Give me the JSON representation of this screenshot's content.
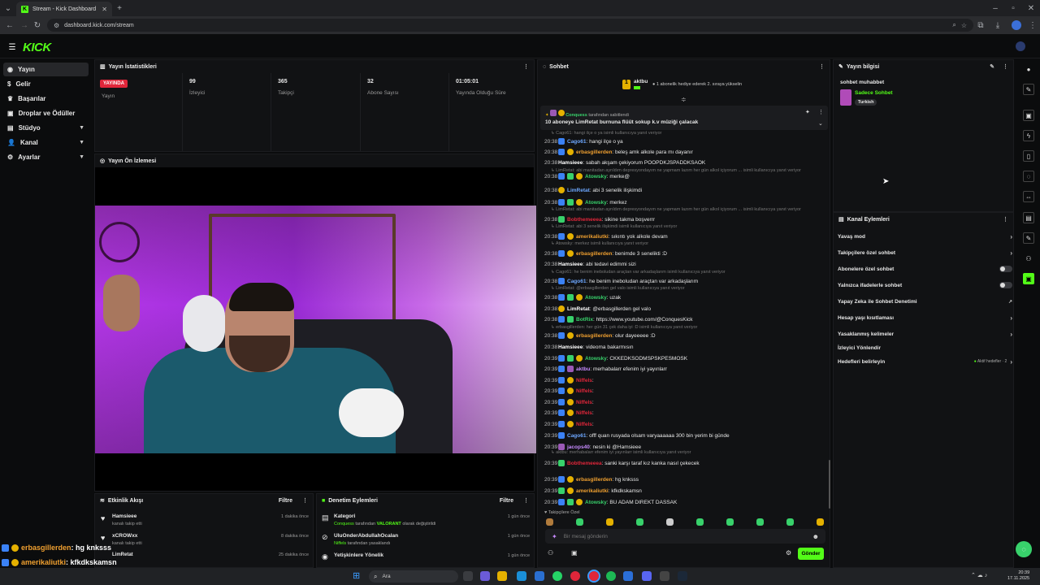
{
  "browser": {
    "tab_title": "Stream - Kick Dashboard",
    "url": "dashboard.kick.com/stream"
  },
  "brand": {
    "logo": "KICK",
    "accent": "#53fc18"
  },
  "sidebar": {
    "items": [
      {
        "label": "Yayın"
      },
      {
        "label": "Gelir"
      },
      {
        "label": "Başarılar"
      },
      {
        "label": "Droplar ve Ödüller"
      },
      {
        "label": "Stüdyo"
      },
      {
        "label": "Kanal"
      },
      {
        "label": "Ayarlar"
      }
    ]
  },
  "stats": {
    "title": "Yayın İstatistikleri",
    "badge": "YAYINDA",
    "badge_label": "Yayın",
    "items": [
      {
        "value": "99",
        "label": "İzleyici"
      },
      {
        "value": "365",
        "label": "Takipçi"
      },
      {
        "value": "32",
        "label": "Abone Sayısı"
      },
      {
        "value": "01:05:01",
        "label": "Yayında Olduğu Süre"
      }
    ]
  },
  "preview": {
    "title": "Yayın Ön İzlemesi"
  },
  "activity": {
    "title": "Etkinlik Akışı",
    "filter": "Filtre",
    "rows": [
      {
        "name": "Hamsieee",
        "sub": "kanalı takip etti",
        "time": "1 dakika önce"
      },
      {
        "name": "xCROWxx",
        "sub": "kanalı takip etti",
        "time": "8 dakika önce"
      },
      {
        "name": "LimRetat",
        "sub": "",
        "time": "25 dakika önce"
      }
    ]
  },
  "moderation": {
    "title": "Denetim Eylemleri",
    "filter": "Filtre",
    "rows": [
      {
        "name": "Kategori",
        "sub_user": "Conquess",
        "sub_mid": "tarafından",
        "sub_val": "VALORANT",
        "sub_end": "olarak değiştirildi",
        "time": "1 gün önce"
      },
      {
        "name": "UluOnderAbdullahOcalan",
        "sub_user": "Niffels",
        "sub_mid": "tarafından yasaklandı",
        "sub_val": "",
        "sub_end": "",
        "time": "1 gün önce"
      },
      {
        "name": "Yetişkinlere Yönelik",
        "sub_user": "",
        "sub_mid": "",
        "sub_val": "",
        "sub_end": "",
        "time": "1 gün önce"
      }
    ]
  },
  "chat": {
    "title": "Sohbet",
    "gift_user": "aktbu",
    "gift_count": "1",
    "gift_text": "1 abonelik hediye ederek 2. sıraya yükselin",
    "pinned_by": "Conquess",
    "pinned_by_suffix": "tarafından sabitlendi",
    "pinned_text": "10 aboneye LimRetat burnuna flüüt sokup k.v müziği çalacak",
    "lines": [
      {
        "time": "20:38",
        "user": "Cago61",
        "text": ": hangi ilçe o ya",
        "color": "#6ea8ff"
      },
      {
        "time": "20:38",
        "user": "erbasgillerden",
        "text": ": beleş amk alkole para mı dayanır",
        "color": "#f0a030"
      },
      {
        "time": "20:38",
        "user": "Hamsieee",
        "text": ": sabah akşam çekiyorum POOPDKJSPADDKSAOK",
        "color": "#fff"
      },
      {
        "time": "20:38",
        "user": "Atowsky",
        "text": ": merke@",
        "color": "#38d16b"
      },
      {
        "time": "20:38",
        "user": "LimRetat",
        "text": ": abi 3 senelik ilişkimdi",
        "color": "#6ea8ff"
      },
      {
        "time": "20:38",
        "user": "Atowsky",
        "text": ": merkez",
        "color": "#38d16b"
      },
      {
        "time": "20:38",
        "user": "Bobthemeeea",
        "text": ": sikine takma boşverrr",
        "color": "#e0263a"
      },
      {
        "time": "20:38",
        "user": "amerikaliutki",
        "text": ": sıkıntı yok alkole devam",
        "color": "#f0a030"
      },
      {
        "time": "20:38",
        "user": "erbasgillerden",
        "text": ": benimde 3 senelikti :D",
        "color": "#f0a030"
      },
      {
        "time": "20:38",
        "user": "Hamsieee",
        "text": ": abi tedavi edimmi sizi",
        "color": "#fff"
      },
      {
        "time": "20:38",
        "user": "Cago61",
        "text": ": he benim ineboludan araçtan var arkadaşlarım",
        "color": "#6ea8ff"
      },
      {
        "time": "20:38",
        "user": "Atowsky",
        "text": ": uzak",
        "color": "#38d16b"
      },
      {
        "time": "20:38",
        "user": "LimRetat",
        "text": ": @erbasgillerden gel valo",
        "color": "#fff"
      },
      {
        "time": "20:38",
        "user": "BotRix",
        "text": ": https://www.youtube.com/@ConquesKick",
        "color": "#38d16b"
      },
      {
        "time": "20:38",
        "user": "erbasgillerden",
        "text": ": olur dayeeeee :D",
        "color": "#f0a030"
      },
      {
        "time": "20:38",
        "user": "Hamsieee",
        "text": ": videoma bakarmısın",
        "color": "#fff"
      },
      {
        "time": "20:39",
        "user": "Atowsky",
        "text": ": CKKEDKSODMSPSKPESMOSK",
        "color": "#38d16b"
      },
      {
        "time": "20:39",
        "user": "aktbu",
        "text": ": merhabalarr efenim iyi yayınlarr",
        "color": "#c78bff"
      },
      {
        "time": "20:39",
        "user": "Niffels",
        "text": ": ",
        "color": "#e0263a"
      },
      {
        "time": "20:39",
        "user": "Niffels",
        "text": ": ",
        "color": "#e0263a"
      },
      {
        "time": "20:39",
        "user": "Niffels",
        "text": ": ",
        "color": "#e0263a"
      },
      {
        "time": "20:39",
        "user": "Niffels",
        "text": ": ",
        "color": "#e0263a"
      },
      {
        "time": "20:39",
        "user": "Niffels",
        "text": ": ",
        "color": "#e0263a"
      },
      {
        "time": "20:39",
        "user": "Cago61",
        "text": ": offf quan rusyada olsam varyaaaaaa 300 bin yerim bi günde",
        "color": "#6ea8ff"
      },
      {
        "time": "20:39",
        "user": "jacops40",
        "text": ": nesin ki @Hamsieee",
        "color": "#c78bff"
      },
      {
        "time": "20:39",
        "user": "Bobthemeeea",
        "text": ": sanki karşı taraf kız kanka nasıl çekecek",
        "color": "#e0263a"
      },
      {
        "time": "20:39",
        "user": "erbasgillerden",
        "text": ": hg knksss",
        "color": "#f0a030"
      },
      {
        "time": "20:39",
        "user": "amerikaliutki",
        "text": ": kfkdkskamsn",
        "color": "#f0a030"
      },
      {
        "time": "20:39",
        "user": "Atowsky",
        "text": ": BU ADAM DIREKT DASSAK",
        "color": "#38d16b"
      }
    ],
    "replies": [
      "Cago61: hangi ilçe o ya isimli kullanıcıya yanıt veriyor",
      "LimRetat: abi manitadan ayrıldım depresyondayım ne yapmam lazım her gün alkol içiyorum ... isimli kullanıcıya yanıt veriyor",
      "LimRetat: abi manitadan ayrıldım depresyondayım ne yapmam lazım her gün alkol içiyorum ... isimli kullanıcıya yanıt veriyor",
      "LimRetat: abi 3 senelik ilişkimdi isimli kullanıcıya yanıt veriyor",
      "Atowsky: merkez isimli kullanıcıya yanıt veriyor",
      "Cago61: he benim ineboludan araçtan var arkadaşlarım isimli kullanıcıya yanıt veriyor",
      "LimRetat: @erbasgillerden gel valo isimli kullanıcıya yanıt veriyor",
      "erbasgillerden: her gün 31 çek daha iyi :D isimli kullanıcıya yanıt veriyor",
      "aktbu: merhabalarr efenim iyi yayınlarr isimli kullanıcıya yanıt veriyor"
    ],
    "followers_only": "Takipçilere Özel",
    "placeholder": "Bir mesaj gönderin",
    "send": "Gönder"
  },
  "stream_info": {
    "title": "Yayın bilgisi",
    "stream_title": "sohbet muhabbet",
    "category": "Sadece Sohbet",
    "tag": "Turkish"
  },
  "channel_actions": {
    "title": "Kanal Eylemleri",
    "items": [
      {
        "label": "Yavaş mod"
      },
      {
        "label": "Takipçilere özel sohbet"
      },
      {
        "label": "Abonelere özel sohbet"
      },
      {
        "label": "Yalnızca ifadelerle sohbet"
      },
      {
        "label": "Yapay Zeka ile Sohbet Denetimi"
      },
      {
        "label": "Hesap yaşı kısıtlaması"
      },
      {
        "label": "Yasaklanmış kelimeler"
      },
      {
        "label": "İzleyici Yönlendir"
      },
      {
        "label": "Hedefleri belirleyin"
      }
    ],
    "goals_status": "Aktif hedefler · 2"
  },
  "overlay": {
    "lines": [
      {
        "user": "erbasgillerden",
        "text": ": hg knksss",
        "color": "#f0a030"
      },
      {
        "user": "amerikaliutki",
        "text": ": kfkdkskamsn",
        "color": "#f0a030"
      },
      {
        "user": "Atowsky",
        "text": ": BU ADAM DIREKT DASSAK",
        "color": "#38d16b"
      }
    ]
  },
  "taskbar": {
    "search": "Ara",
    "time": "20:39",
    "date": "17.11.2025"
  }
}
